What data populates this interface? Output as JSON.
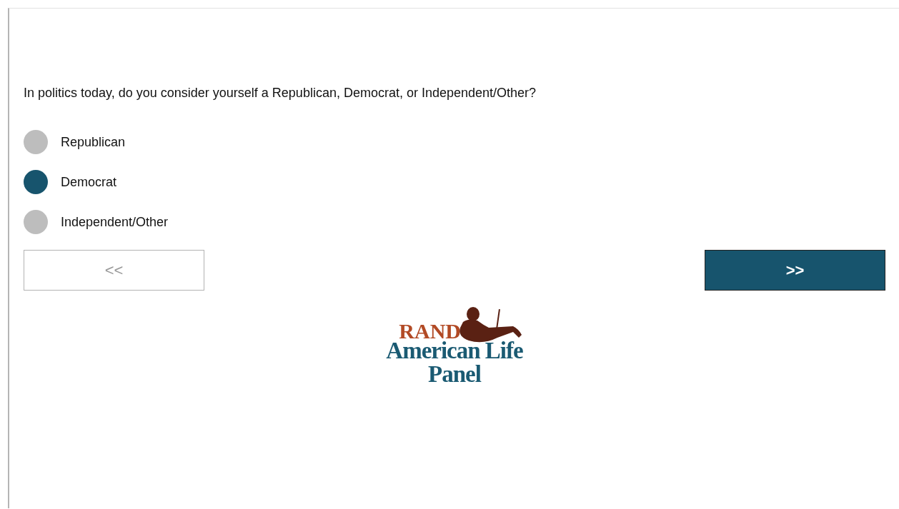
{
  "question": "In politics today, do you consider yourself a Republican, Democrat, or Independent/Other?",
  "options": [
    {
      "label": "Republican",
      "selected": false
    },
    {
      "label": "Democrat",
      "selected": true
    },
    {
      "label": "Independent/Other",
      "selected": false
    }
  ],
  "buttons": {
    "back": "<<",
    "next": ">>"
  },
  "logo": {
    "top": "RAND",
    "middle": "American Life",
    "bottom": "Panel"
  }
}
